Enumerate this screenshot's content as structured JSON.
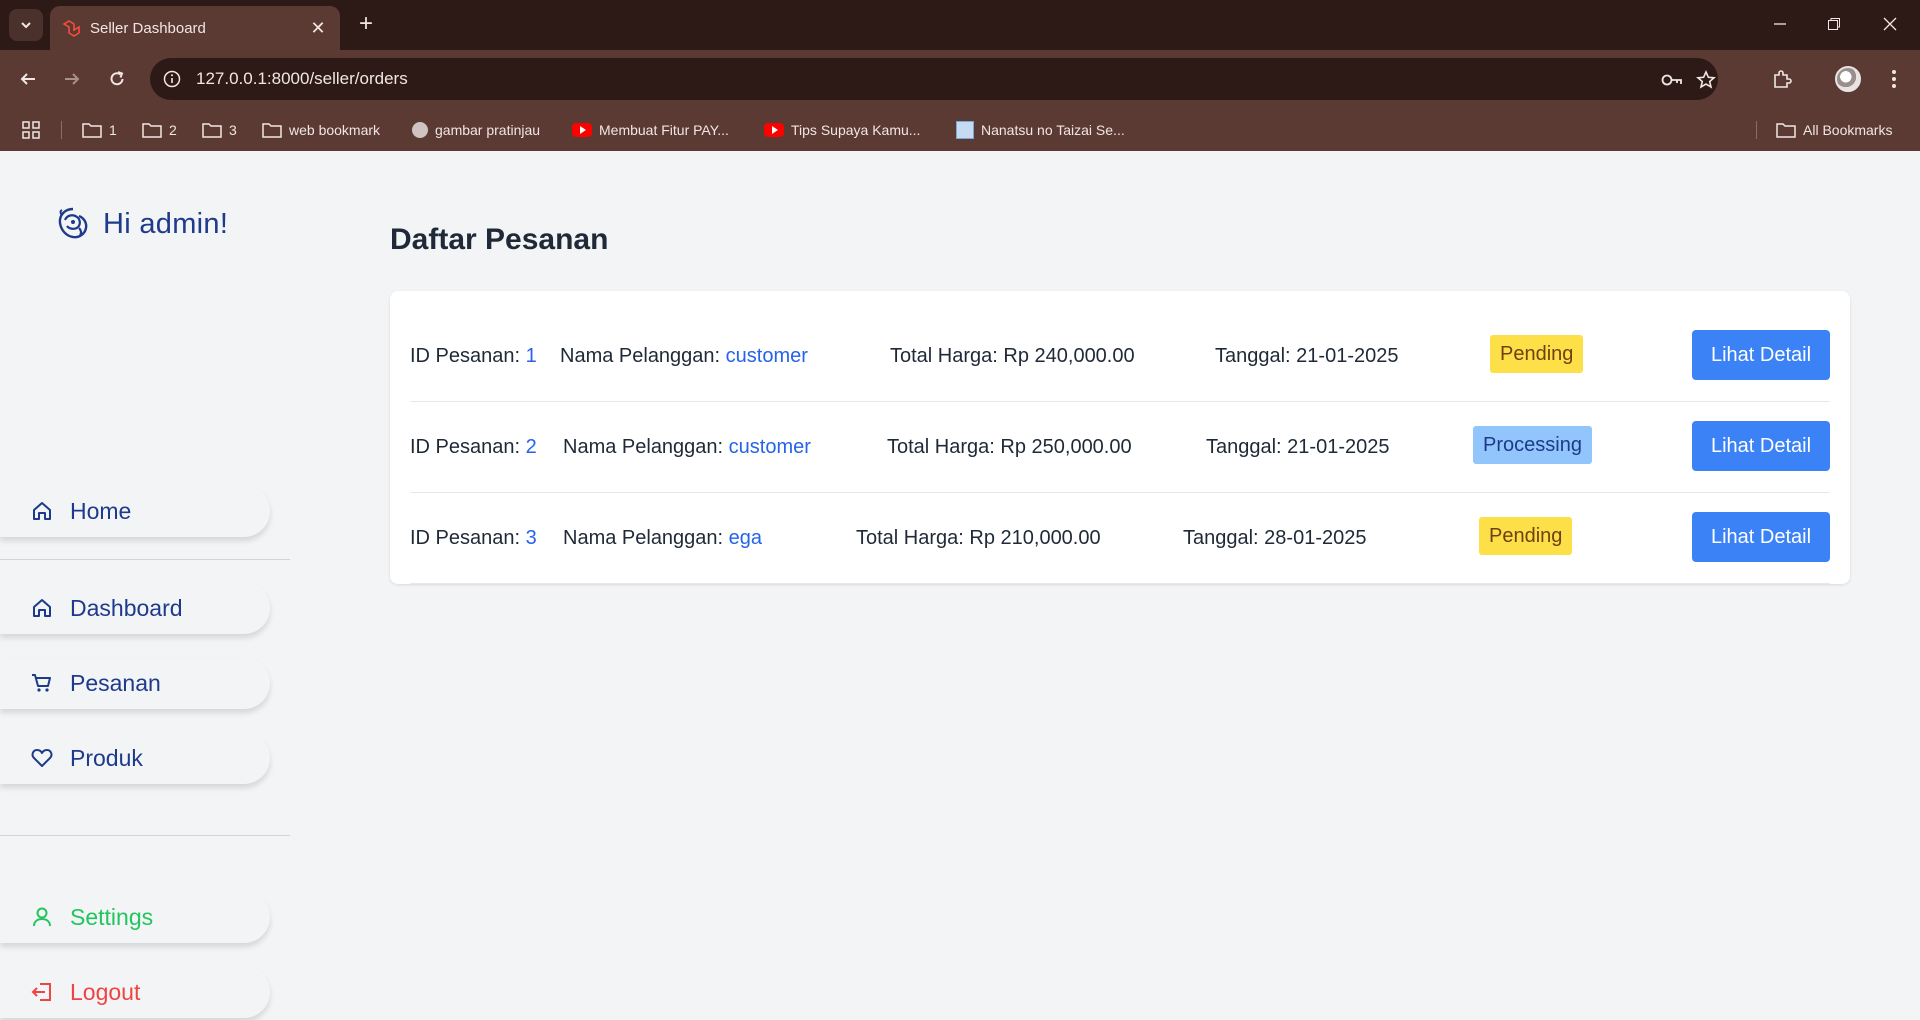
{
  "browser": {
    "tab_title": "Seller Dashboard",
    "url": "127.0.0.1:8000/seller/orders",
    "bookmarks": [
      {
        "label": "1",
        "icon": "folder-icon"
      },
      {
        "label": "2",
        "icon": "folder-icon"
      },
      {
        "label": "3",
        "icon": "folder-icon"
      },
      {
        "label": "web bookmark",
        "icon": "folder-icon"
      },
      {
        "label": "gambar pratinjau",
        "icon": "globe-icon"
      },
      {
        "label": "Membuat Fitur PAY...",
        "icon": "youtube-icon"
      },
      {
        "label": "Tips Supaya Kamu...",
        "icon": "youtube-icon"
      },
      {
        "label": "Nanatsu no Taizai Se...",
        "icon": "book-icon"
      }
    ],
    "all_bookmarks": "All Bookmarks"
  },
  "sidebar": {
    "greeting": "Hi admin!",
    "items": [
      {
        "label": "Home",
        "icon": "home-icon"
      },
      {
        "label": "Dashboard",
        "icon": "home-icon"
      },
      {
        "label": "Pesanan",
        "icon": "cart-icon"
      },
      {
        "label": "Produk",
        "icon": "heart-icon"
      },
      {
        "label": "Settings",
        "icon": "user-icon"
      },
      {
        "label": "Logout",
        "icon": "logout-icon"
      }
    ]
  },
  "main": {
    "title": "Daftar Pesanan",
    "labels": {
      "id": "ID Pesanan: ",
      "customer": "Nama Pelanggan: ",
      "total": "Total Harga: ",
      "date": "Tanggal: ",
      "detail_button": "Lihat Detail"
    },
    "orders": [
      {
        "id": "1",
        "customer": "customer",
        "total": "Rp 240,000.00",
        "date": "21-01-2025",
        "status": "Pending"
      },
      {
        "id": "2",
        "customer": "customer",
        "total": "Rp 250,000.00",
        "date": "21-01-2025",
        "status": "Processing"
      },
      {
        "id": "3",
        "customer": "ega",
        "total": "Rp 210,000.00",
        "date": "28-01-2025",
        "status": "Pending"
      }
    ]
  },
  "colors": {
    "primary_text": "#1e3a8a",
    "link": "#2563eb",
    "button": "#3b82f6",
    "pending": "#fde047",
    "processing": "#93c5fd",
    "settings": "#22c55e",
    "logout": "#ef4444",
    "chrome_dark": "#2d1a16",
    "chrome_bar": "#5a3a33"
  }
}
